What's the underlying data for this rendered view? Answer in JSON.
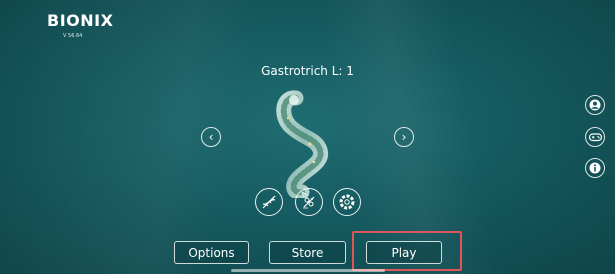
{
  "app": {
    "logo": "BIONIX",
    "version": "V 56.64"
  },
  "creature": {
    "title": "Gastrotrich L: 1"
  },
  "nav": {
    "prev_glyph": "‹",
    "next_glyph": "›"
  },
  "side_buttons": [
    {
      "icon": "profile-icon"
    },
    {
      "icon": "gamepad-icon"
    },
    {
      "icon": "info-icon"
    }
  ],
  "abilities": [
    {
      "icon": "dna-icon"
    },
    {
      "icon": "evolution-icon"
    },
    {
      "icon": "cell-ring-icon"
    }
  ],
  "menu": {
    "options_label": "Options",
    "store_label": "Store",
    "play_label": "Play"
  },
  "colors": {
    "highlight": "#e05558",
    "background": "#155a60"
  }
}
